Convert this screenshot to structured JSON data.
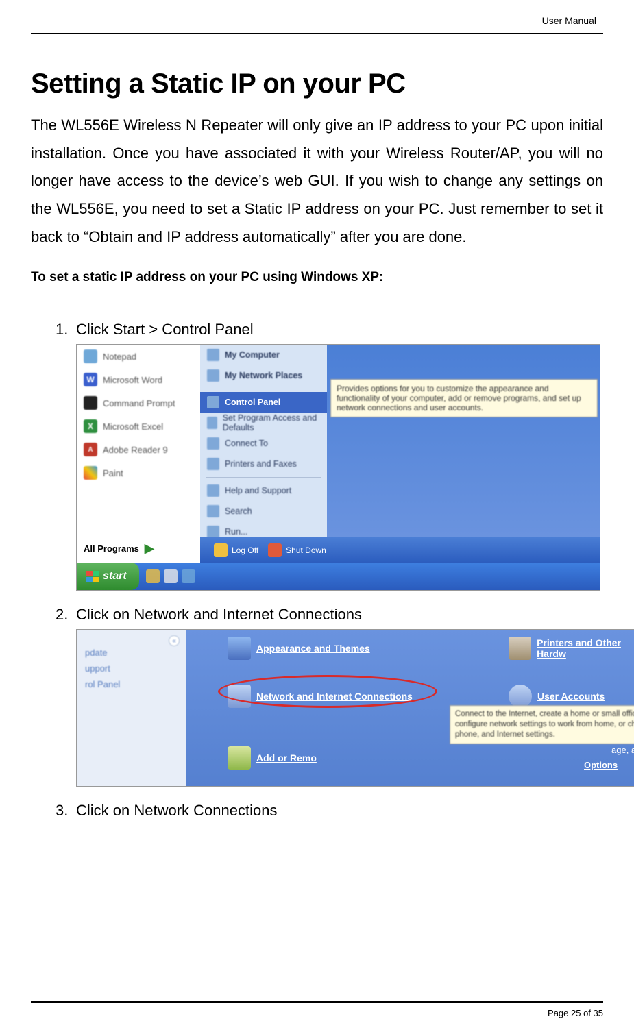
{
  "header": {
    "label": "User Manual"
  },
  "title": "Setting a Static IP on your PC",
  "intro": "The WL556E Wireless N Repeater will only give an IP address to your PC upon initial installation. Once you have associated it with your Wireless Router/AP, you will no longer have access to the device’s web GUI. If you wish to change any settings on the WL556E, you need to set a Static IP address on your PC. Just remember to set it back to “Obtain and IP address automatically” after you are done.",
  "subhead": "To set a static IP address on your PC using Windows XP:",
  "steps": {
    "s1": {
      "num": "1.",
      "text": "Click Start > Control Panel"
    },
    "s2": {
      "num": "2.",
      "text": "Click on Network and Internet Connections"
    },
    "s3": {
      "num": "3.",
      "text": "Click on Network Connections"
    }
  },
  "shot1": {
    "left_items": [
      "Notepad",
      "Microsoft Word",
      "Command Prompt",
      "Microsoft Excel",
      "Adobe Reader 9",
      "Paint"
    ],
    "all_programs": "All Programs",
    "mid_items": {
      "my_computer": "My Computer",
      "my_network": "My Network Places",
      "control_panel": "Control Panel",
      "set_program": "Set Program Access and Defaults",
      "connect_to": "Connect To",
      "printers": "Printers and Faxes",
      "help": "Help and Support",
      "search": "Search",
      "run": "Run..."
    },
    "tooltip": "Provides options for you to customize the appearance and functionality of your computer, add or remove programs, and set up network connections and user accounts.",
    "logoff": "Log Off",
    "shutdown": "Shut Down",
    "start": "start"
  },
  "shot2": {
    "left": {
      "update": "pdate",
      "support": "upport",
      "rol_panel": "rol Panel"
    },
    "appearance": "Appearance and Themes",
    "network": "Network and Internet Connections",
    "add_remove": "Add or Remo",
    "printers": "Printers and Other Hardw",
    "users": "User Accounts",
    "options": "Options",
    "age_an": "age, an",
    "tooltip": "Connect to the Internet, create a home or small office network, configure network settings to work from home, or change modem, phone, and Internet settings."
  },
  "footer": {
    "page": "Page 25 of 35"
  }
}
